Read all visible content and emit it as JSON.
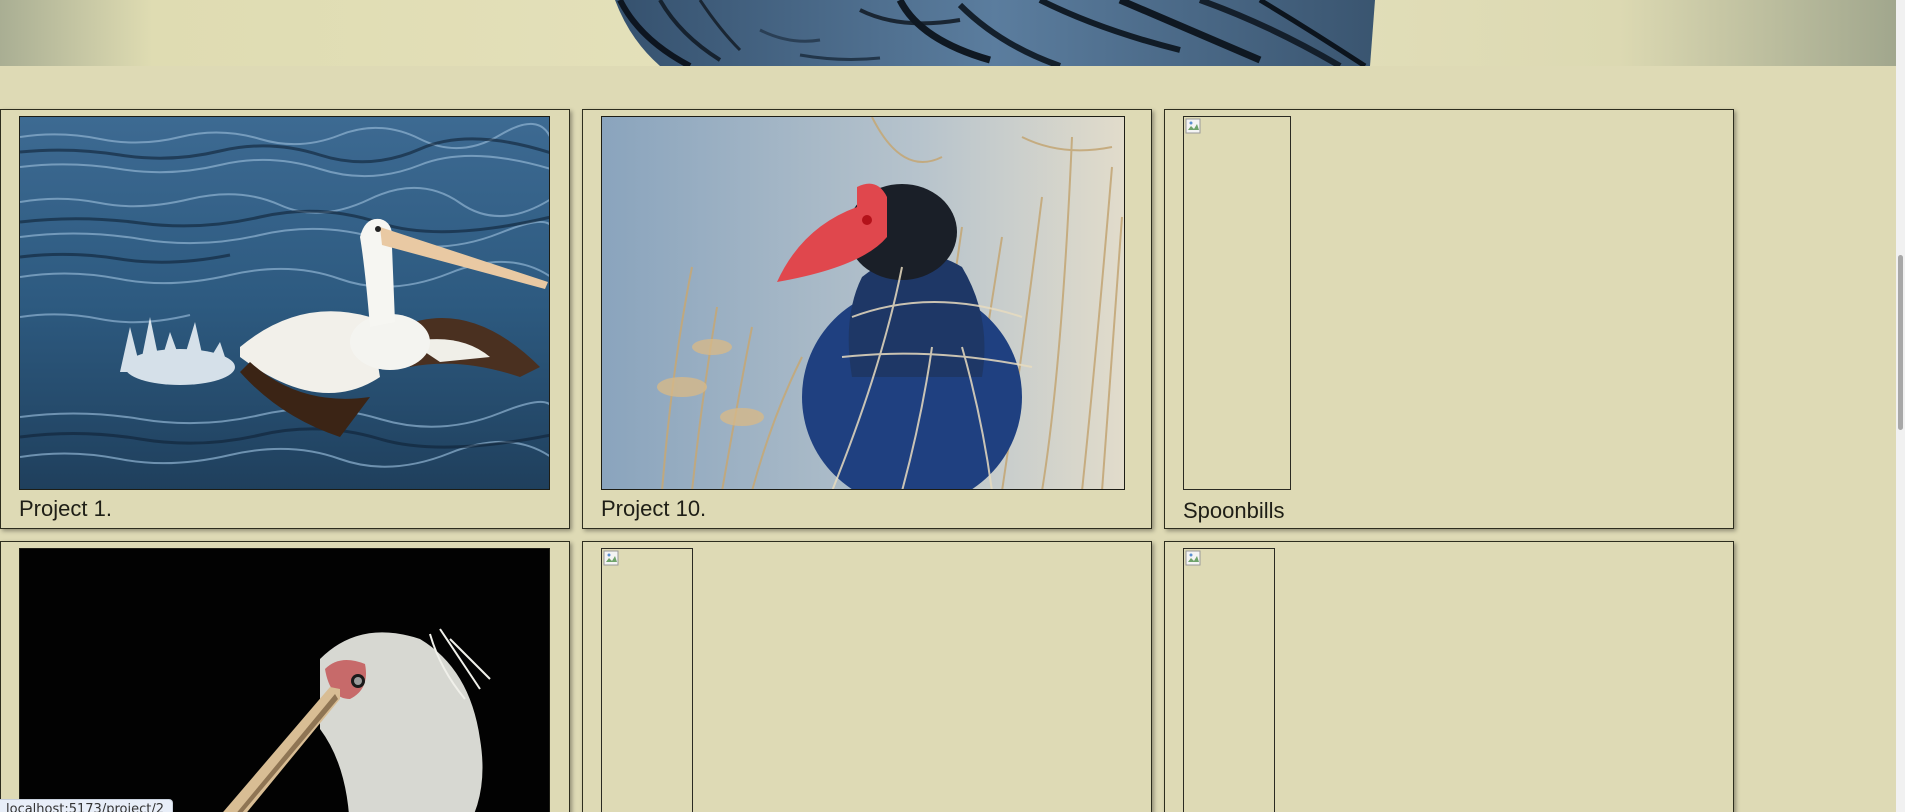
{
  "hero": {
    "image_alt": "purple swamphen banner"
  },
  "projects": [
    {
      "caption": "Project 1.",
      "image": "pelican-taking-off-photo",
      "loaded": true
    },
    {
      "caption": "Project 10.",
      "image": "purple-swamphen-photo",
      "loaded": true
    },
    {
      "caption": "Spoonbills",
      "image": "broken-image",
      "loaded": false
    },
    {
      "caption": "",
      "image": "spoonbill-portrait-photo",
      "loaded": true
    },
    {
      "caption": "",
      "image": "broken-image",
      "loaded": false
    },
    {
      "caption": "",
      "image": "broken-image",
      "loaded": false
    }
  ],
  "status": {
    "url": "localhost:5173/project/2"
  },
  "colors": {
    "background": "#dedab5",
    "border": "#2d2d1e"
  }
}
